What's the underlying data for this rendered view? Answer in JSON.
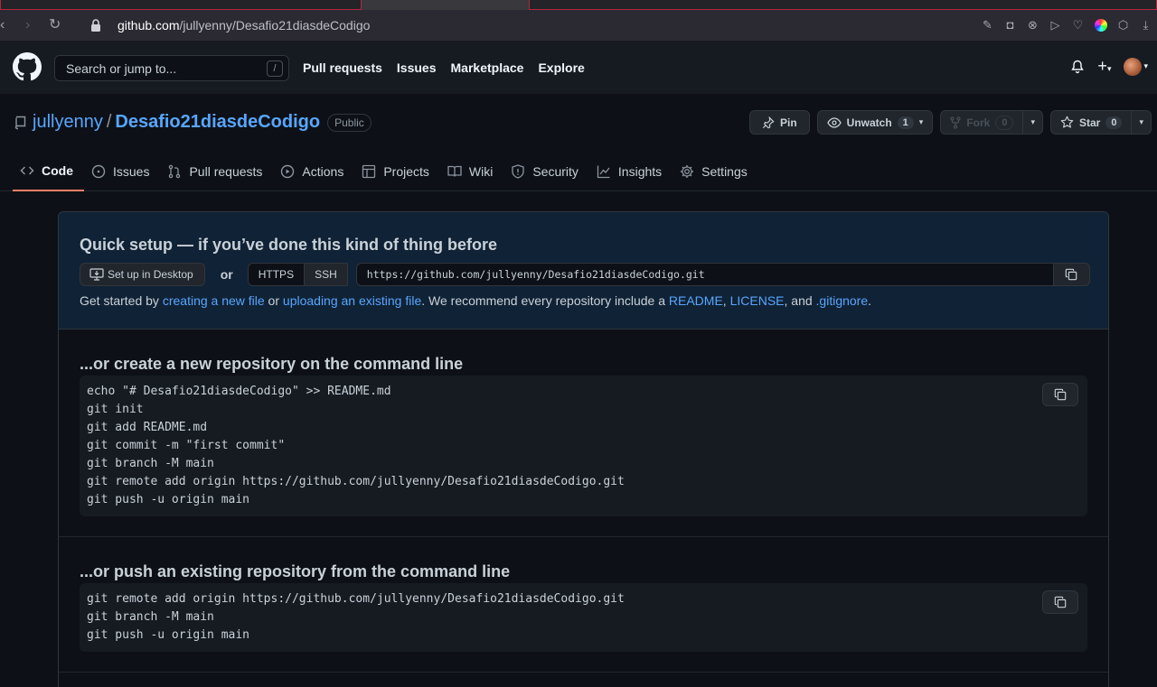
{
  "browser": {
    "url_host": "github.com",
    "url_path": "/jullyenny/Desafio21diasdeCodigo"
  },
  "header": {
    "search_placeholder": "Search or jump to...",
    "search_shortcut": "/",
    "nav": [
      "Pull requests",
      "Issues",
      "Marketplace",
      "Explore"
    ]
  },
  "repo": {
    "owner": "jullyenny",
    "separator": "/",
    "name": "Desafio21diasdeCodigo",
    "visibility": "Public",
    "pin_label": "Pin",
    "watch_label": "Unwatch",
    "watch_count": "1",
    "fork_label": "Fork",
    "fork_count": "0",
    "star_label": "Star",
    "star_count": "0"
  },
  "tabs": [
    {
      "label": "Code",
      "selected": true
    },
    {
      "label": "Issues"
    },
    {
      "label": "Pull requests"
    },
    {
      "label": "Actions"
    },
    {
      "label": "Projects"
    },
    {
      "label": "Wiki"
    },
    {
      "label": "Security"
    },
    {
      "label": "Insights"
    },
    {
      "label": "Settings"
    }
  ],
  "quick_setup": {
    "title": "Quick setup — if you’ve done this kind of thing before",
    "desktop_button": "Set up in Desktop",
    "or": "or",
    "https": "HTTPS",
    "ssh": "SSH",
    "clone_url": "https://github.com/jullyenny/Desafio21diasdeCodigo.git",
    "text_1": "Get started by ",
    "link_new_file": "creating a new file",
    "text_2": " or ",
    "link_upload": "uploading an existing file",
    "text_3": ". We recommend every repository include a ",
    "link_readme": "README",
    "text_4": ", ",
    "link_license": "LICENSE",
    "text_5": ", and ",
    "link_gitignore": ".gitignore",
    "text_6": "."
  },
  "new_repo": {
    "title": "...or create a new repository on the command line",
    "code": "echo \"# Desafio21diasdeCodigo\" >> README.md\ngit init\ngit add README.md\ngit commit -m \"first commit\"\ngit branch -M main\ngit remote add origin https://github.com/jullyenny/Desafio21diasdeCodigo.git\ngit push -u origin main"
  },
  "push_existing": {
    "title": "...or push an existing repository from the command line",
    "code": "git remote add origin https://github.com/jullyenny/Desafio21diasdeCodigo.git\ngit branch -M main\ngit push -u origin main"
  },
  "colors": {
    "accent_link": "#58a6ff",
    "tab_underline": "#f78166",
    "background": "#0d1117"
  }
}
